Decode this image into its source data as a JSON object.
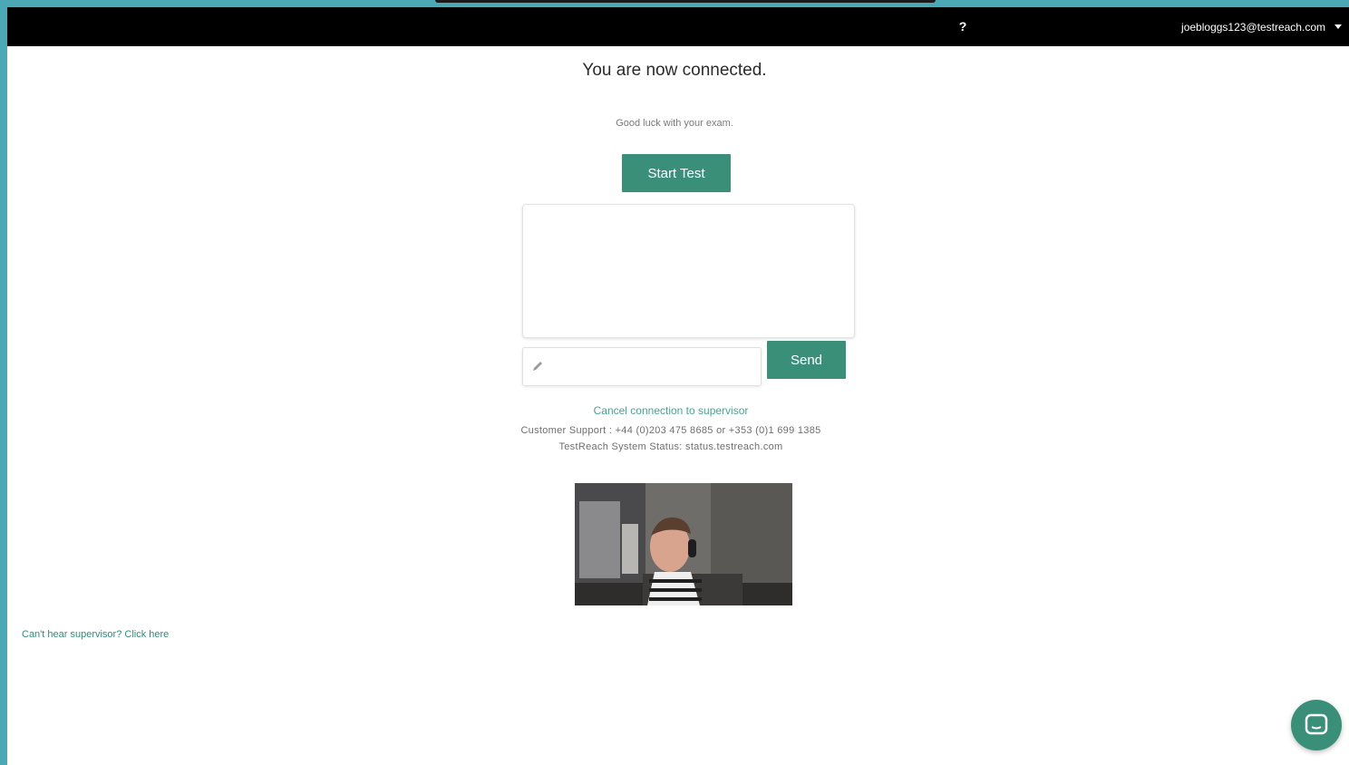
{
  "header": {
    "help_label": "?",
    "user_email": "joebloggs123@testreach.com"
  },
  "main": {
    "title": "You are now connected.",
    "subtitle": "Good luck with your exam.",
    "start_button": "Start Test",
    "message_input": {
      "value": "",
      "placeholder": ""
    },
    "send_button": "Send",
    "cancel_link": "Cancel connection to supervisor",
    "support_line": "Customer Support : +44 (0)203 475 8685 or +353 (0)1 699 1385",
    "status_line": "TestReach System Status: status.testreach.com"
  },
  "footer": {
    "cant_hear_link": "Can't hear supervisor? Click here"
  },
  "colors": {
    "accent": "#3a8f79",
    "link": "#43a593",
    "topbar": "#000000",
    "outer_border": "#4aa9b5"
  },
  "icons": {
    "help": "help-icon",
    "dropdown": "caret-down-icon",
    "input": "pencil-icon",
    "launcher": "chat-bubble-icon"
  }
}
